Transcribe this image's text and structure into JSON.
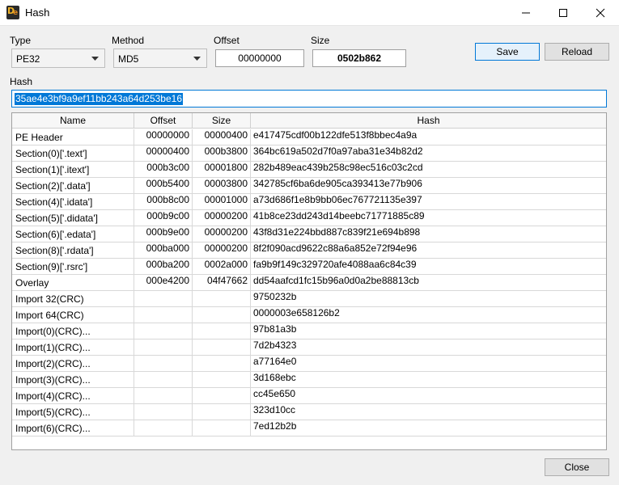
{
  "window": {
    "title": "Hash",
    "icon": "die-app-icon"
  },
  "controls": {
    "type_label": "Type",
    "type_value": "PE32",
    "method_label": "Method",
    "method_value": "MD5",
    "offset_label": "Offset",
    "offset_value": "00000000",
    "size_label": "Size",
    "size_value": "0502b862",
    "save_label": "Save",
    "reload_label": "Reload",
    "hash_label": "Hash",
    "hash_value": "35ae4e3bf9a9ef11bb243a64d253be16",
    "close_label": "Close"
  },
  "table": {
    "headers": [
      "Name",
      "Offset",
      "Size",
      "Hash"
    ],
    "rows": [
      {
        "name": "PE Header",
        "offset": "00000000",
        "size": "00000400",
        "hash": "e417475cdf00b122dfe513f8bbec4a9a"
      },
      {
        "name": "Section(0)['.text']",
        "offset": "00000400",
        "size": "000b3800",
        "hash": "364bc619a502d7f0a97aba31e34b82d2"
      },
      {
        "name": "Section(1)['.itext']",
        "offset": "000b3c00",
        "size": "00001800",
        "hash": "282b489eac439b258c98ec516c03c2cd"
      },
      {
        "name": "Section(2)['.data']",
        "offset": "000b5400",
        "size": "00003800",
        "hash": "342785cf6ba6de905ca393413e77b906"
      },
      {
        "name": "Section(4)['.idata']",
        "offset": "000b8c00",
        "size": "00001000",
        "hash": "a73d686f1e8b9bb06ec767721135e397"
      },
      {
        "name": "Section(5)['.didata']",
        "offset": "000b9c00",
        "size": "00000200",
        "hash": "41b8ce23dd243d14beebc71771885c89"
      },
      {
        "name": "Section(6)['.edata']",
        "offset": "000b9e00",
        "size": "00000200",
        "hash": "43f8d31e224bbd887c839f21e694b898"
      },
      {
        "name": "Section(8)['.rdata']",
        "offset": "000ba000",
        "size": "00000200",
        "hash": "8f2f090acd9622c88a6a852e72f94e96"
      },
      {
        "name": "Section(9)['.rsrc']",
        "offset": "000ba200",
        "size": "0002a000",
        "hash": "fa9b9f149c329720afe4088aa6c84c39"
      },
      {
        "name": "Overlay",
        "offset": "000e4200",
        "size": "04f47662",
        "hash": "dd54aafcd1fc15b96a0d0a2be88813cb"
      },
      {
        "name": "Import 32(CRC)",
        "offset": "",
        "size": "",
        "hash": "9750232b"
      },
      {
        "name": "Import 64(CRC)",
        "offset": "",
        "size": "",
        "hash": "0000003e658126b2"
      },
      {
        "name": "Import(0)(CRC)...",
        "offset": "",
        "size": "",
        "hash": "97b81a3b"
      },
      {
        "name": "Import(1)(CRC)...",
        "offset": "",
        "size": "",
        "hash": "7d2b4323"
      },
      {
        "name": "Import(2)(CRC)...",
        "offset": "",
        "size": "",
        "hash": "a77164e0"
      },
      {
        "name": "Import(3)(CRC)...",
        "offset": "",
        "size": "",
        "hash": "3d168ebc"
      },
      {
        "name": "Import(4)(CRC)...",
        "offset": "",
        "size": "",
        "hash": "cc45e650"
      },
      {
        "name": "Import(5)(CRC)...",
        "offset": "",
        "size": "",
        "hash": "323d10cc"
      },
      {
        "name": "Import(6)(CRC)...",
        "offset": "",
        "size": "",
        "hash": "7ed12b2b"
      }
    ]
  },
  "colors": {
    "accent": "#0078d7",
    "selection_text": "#ffffff"
  }
}
